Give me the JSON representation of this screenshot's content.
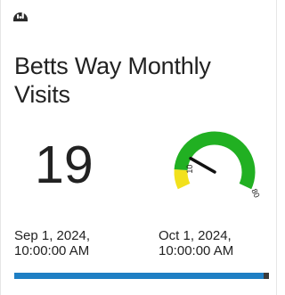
{
  "header": {
    "icon": "speedometer-icon"
  },
  "card": {
    "title": "Betts Way Monthly Visits",
    "value": "19",
    "gauge": {
      "value": 19,
      "min": 0,
      "max": 80,
      "threshold": 10,
      "min_label": "10",
      "max_label": "80",
      "colors": {
        "low": "#f2e11c",
        "high": "#21b022",
        "needle": "#111111"
      }
    },
    "start_date_line1": "Sep 1, 2024,",
    "start_date_line2": "10:00:00 AM",
    "end_date_line1": "Oct 1, 2024,",
    "end_date_line2": "10:00:00 AM",
    "progress": 0.98,
    "progress_color": "#1f7fc4"
  }
}
